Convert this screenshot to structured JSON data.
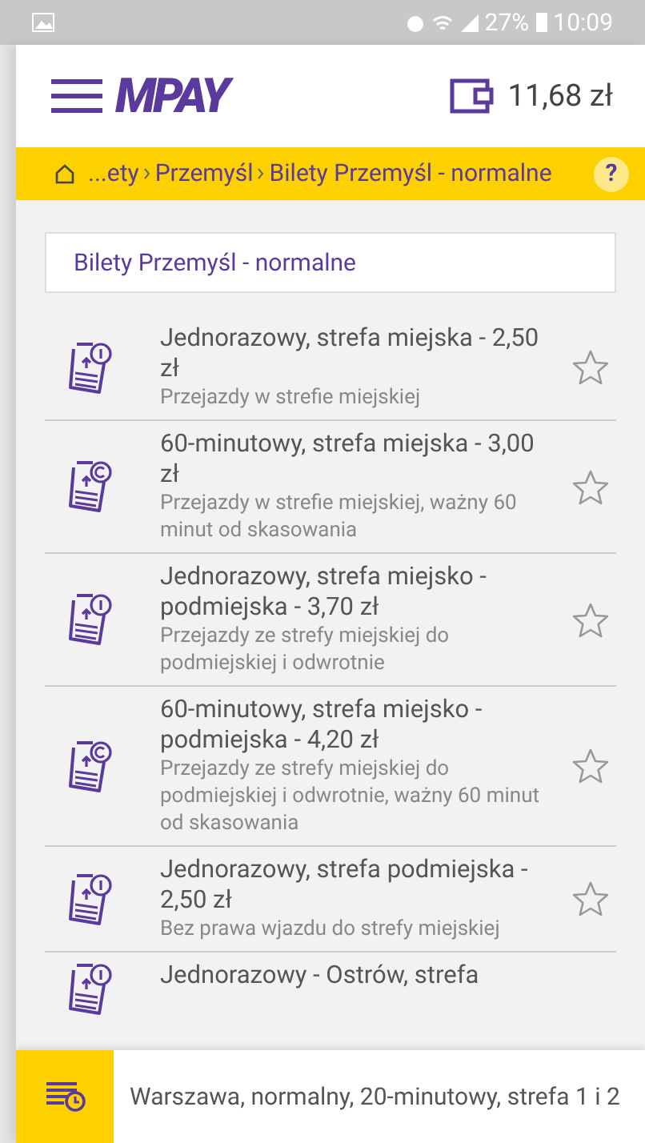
{
  "status_bar": {
    "battery": "27%",
    "time": "10:09"
  },
  "header": {
    "logo": "MPAY",
    "balance": "11,68 zł"
  },
  "breadcrumb": {
    "items": [
      "...ety",
      "Przemyśl",
      "Bilety Przemyśl - normalne"
    ],
    "help": "?"
  },
  "category": "Bilety Przemyśl - normalne",
  "tickets": [
    {
      "kind": "single",
      "title": "Jednorazowy, strefa miejska - 2,50 zł",
      "description": "Przejazdy w strefie miejskiej",
      "favorite": false
    },
    {
      "kind": "timed",
      "title": "60-minutowy, strefa miejska - 3,00 zł",
      "description": "Przejazdy w strefie miejskiej, ważny 60 minut od skasowania",
      "favorite": false
    },
    {
      "kind": "single",
      "title": "Jednorazowy, strefa miejsko - podmiejska - 3,70 zł",
      "description": "Przejazdy ze strefy miejskiej do podmiejskiej i odwrotnie",
      "favorite": false
    },
    {
      "kind": "timed",
      "title": "60-minutowy, strefa miejsko - podmiejska - 4,20 zł",
      "description": "Przejazdy ze strefy miejskiej do podmiejskiej i odwrotnie, ważny 60 minut od skasowania",
      "favorite": false
    },
    {
      "kind": "single",
      "title": "Jednorazowy, strefa podmiejska - 2,50 zł",
      "description": "Bez prawa wjazdu do strefy miejskiej",
      "favorite": false
    },
    {
      "kind": "single",
      "title": "Jednorazowy - Ostrów, strefa"
    }
  ],
  "last_ticket": "Warszawa, normalny, 20-minutowy, strefa 1 i 2"
}
